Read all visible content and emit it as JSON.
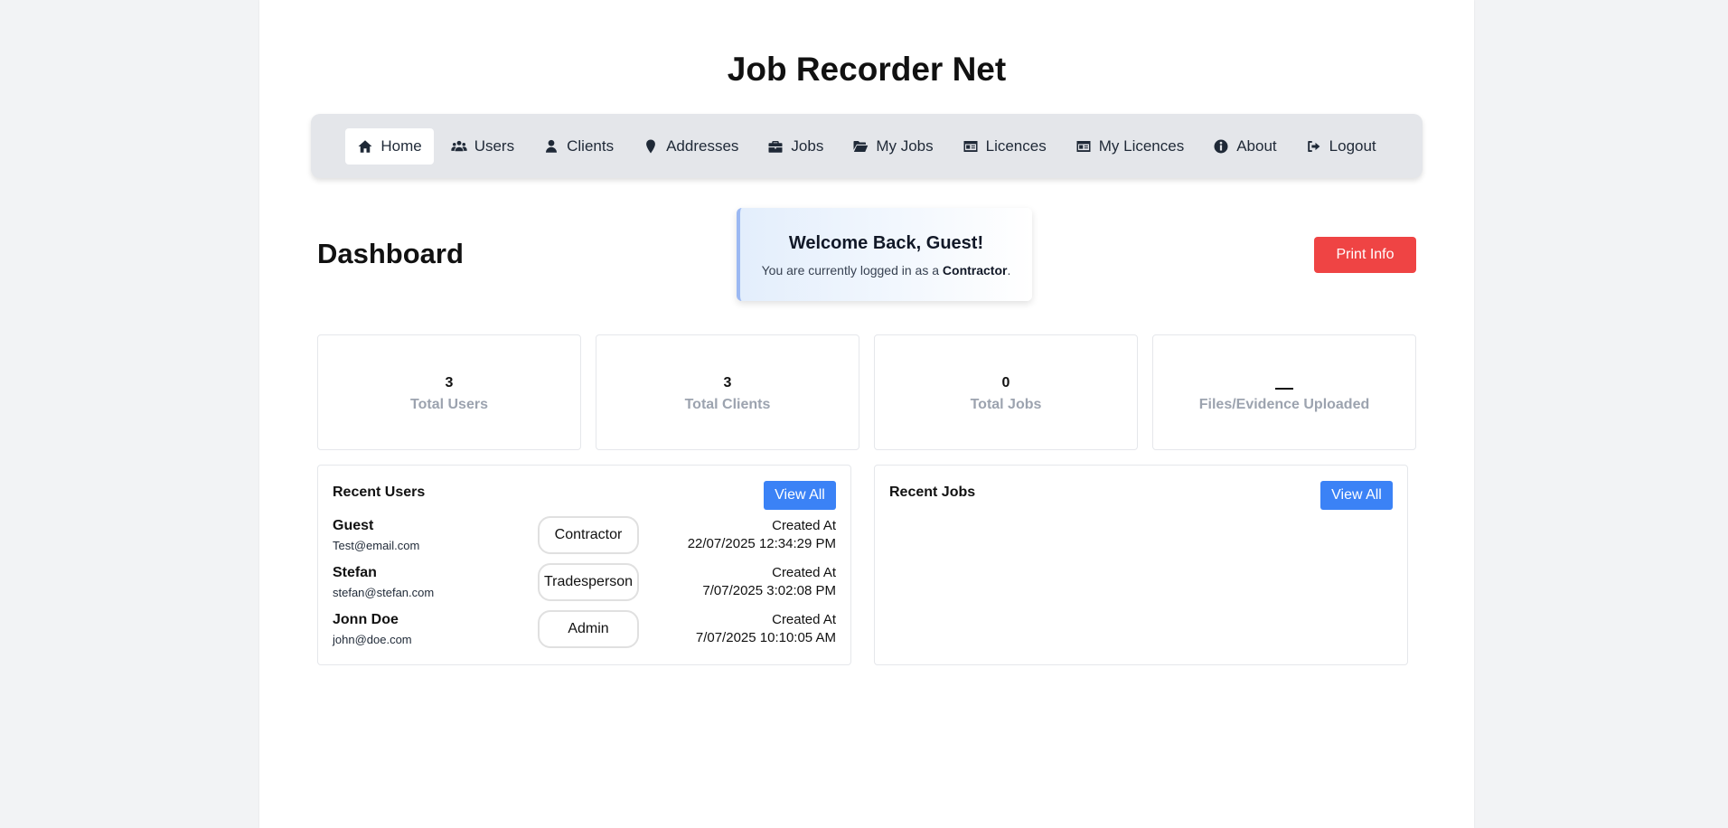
{
  "app_title": "Job Recorder Net",
  "nav": [
    {
      "label": "Home",
      "icon": "home-icon"
    },
    {
      "label": "Users",
      "icon": "users-icon"
    },
    {
      "label": "Clients",
      "icon": "user-icon"
    },
    {
      "label": "Addresses",
      "icon": "map-pin-icon"
    },
    {
      "label": "Jobs",
      "icon": "briefcase-icon"
    },
    {
      "label": "My Jobs",
      "icon": "folder-open-icon"
    },
    {
      "label": "Licences",
      "icon": "id-card-icon"
    },
    {
      "label": "My Licences",
      "icon": "id-card-icon"
    },
    {
      "label": "About",
      "icon": "info-icon"
    },
    {
      "label": "Logout",
      "icon": "logout-icon"
    }
  ],
  "active_nav": "Home",
  "dashboard": {
    "title": "Dashboard",
    "welcome": {
      "title": "Welcome Back, Guest!",
      "prefix": "You are currently logged in as a ",
      "role": "Contractor",
      "suffix": "."
    },
    "print_label": "Print Info"
  },
  "stats": [
    {
      "value": "3",
      "label": "Total Users"
    },
    {
      "value": "3",
      "label": "Total Clients"
    },
    {
      "value": "0",
      "label": "Total Jobs"
    },
    {
      "value": "",
      "label": "Files/Evidence Uploaded"
    }
  ],
  "recent_users": {
    "title": "Recent Users",
    "view_all": "View All",
    "created_label": "Created At",
    "items": [
      {
        "name": "Guest",
        "email": "Test@email.com",
        "role": "Contractor",
        "created": "22/07/2025 12:34:29 PM"
      },
      {
        "name": "Stefan",
        "email": "stefan@stefan.com",
        "role": "Tradesperson",
        "created": "7/07/2025 3:02:08 PM"
      },
      {
        "name": "Jonn Doe",
        "email": "john@doe.com",
        "role": "Admin",
        "created": "7/07/2025 10:10:05 AM"
      }
    ]
  },
  "recent_jobs": {
    "title": "Recent Jobs",
    "view_all": "View All"
  },
  "colors": {
    "accent_blue": "#3b82f6",
    "danger_red": "#ef4444",
    "navbar_bg": "#e4e6ea",
    "page_bg": "#f2f3f5"
  }
}
